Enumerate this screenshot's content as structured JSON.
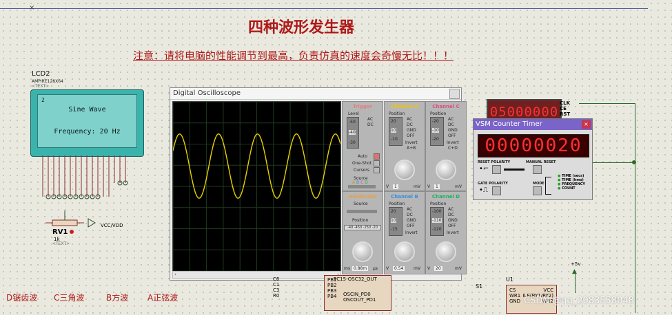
{
  "header": {
    "title": "四种波形发生器",
    "warning": "注意：请将电脑的性能调节到最高，负责仿真的速度会奇慢无比！！！"
  },
  "lcd": {
    "name": "LCD2",
    "model": "AMPIRE128X64",
    "text_tag": "<TEXT>",
    "screen_index": "2",
    "line1": "Sine Wave",
    "line2": "Frequency: 20 Hz"
  },
  "pot": {
    "name": "RV1",
    "value": "1k",
    "text_tag": "<TEXT>",
    "supply_label": "VCC/VDD"
  },
  "oscilloscope": {
    "title": "Digital Oscilloscope",
    "trigger_title": "Trigger",
    "level_label": "Level",
    "trigger_ticks": [
      "-50",
      "-40",
      "-30"
    ],
    "auto_label": "Auto",
    "oneshot_label": "One-Shot",
    "cursors_label": "Cursors",
    "source_label": "Source",
    "source_channels": [
      "A",
      "B",
      "C",
      "D"
    ],
    "horizontal_title": "Horizontal",
    "position_label": "Position",
    "h_position_readout": "-40 -450 -250 -20",
    "ms_label": "ms",
    "us_label": "µs",
    "h_readout": "0.88m",
    "channels": [
      {
        "name": "Channel A",
        "color": "#f2c400",
        "ticks": [
          "20",
          "10",
          "-10"
        ],
        "ac": "AC",
        "dc": "DC",
        "gnd": "GND",
        "off": "OFF",
        "invert": "Invert",
        "sum": "A+B",
        "readout": "1",
        "unit": "mV",
        "v": "V"
      },
      {
        "name": "Channel C",
        "color": "#e05080",
        "ticks": [
          "-20",
          "-10",
          "-20"
        ],
        "ac": "AC",
        "dc": "DC",
        "gnd": "GND",
        "off": "OFF",
        "invert": "Invert",
        "sum": "C+D",
        "readout": "1",
        "unit": "mV",
        "v": "V"
      },
      {
        "name": "Channel B",
        "color": "#3a8fe0",
        "ticks": [
          "20",
          "10",
          "-15"
        ],
        "ac": "AC",
        "dc": "DC",
        "gnd": "GND",
        "off": "OFF",
        "invert": "Invert",
        "readout": "0.54",
        "unit": "mV",
        "v": "V"
      },
      {
        "name": "Channel D",
        "color": "#20b060",
        "ticks": [
          "-100",
          "-110",
          "-120"
        ],
        "ac": "AC",
        "dc": "DC",
        "gnd": "GND",
        "off": "OFF",
        "invert": "Invert",
        "readout": "20",
        "unit": "mV",
        "v": "V"
      }
    ],
    "waveform": {
      "type": "sine",
      "color": "#e8d000",
      "cycles": 4.3
    }
  },
  "counter_small": {
    "digits": "05000000",
    "pins": [
      "CLK",
      "CE",
      "RST"
    ]
  },
  "vsm_counter": {
    "title": "VSM Counter Timer",
    "close": "×",
    "display": "00000020",
    "reset_polarity": "RESET POLARITY",
    "manual_reset": "MANUAL RESET",
    "gate_polarity": "GATE POLARITY",
    "mode": "MODE",
    "modes": [
      "TIME (secs)",
      "TIME (hms)",
      "FREQUENCY",
      "COUNT"
    ],
    "display_color": "#ff2020"
  },
  "bottom_labels": {
    "d": "D锯齿波",
    "c": "C三角波",
    "b": "B方波",
    "a": "A正弦波"
  },
  "mcu_pins": {
    "left": [
      "C6",
      "C1",
      "C3",
      "R0"
    ],
    "right": [
      "PB1",
      "PB2",
      "PB3",
      "PB4"
    ],
    "osc": "PC15-OSC32_OUT",
    "osc_in": "OSCIN_PD0",
    "osc_out": "OSCOUT_PD1"
  },
  "dac_chip": {
    "name": "U1",
    "pins_left": [
      "CS",
      "WR1",
      "GND"
    ],
    "pins_right": [
      "VCC",
      "ILE(BY1/BY2)",
      "WR2"
    ],
    "label": "S1",
    "supply": "+5v"
  },
  "watermark": "CSDN @qq_2083558048"
}
